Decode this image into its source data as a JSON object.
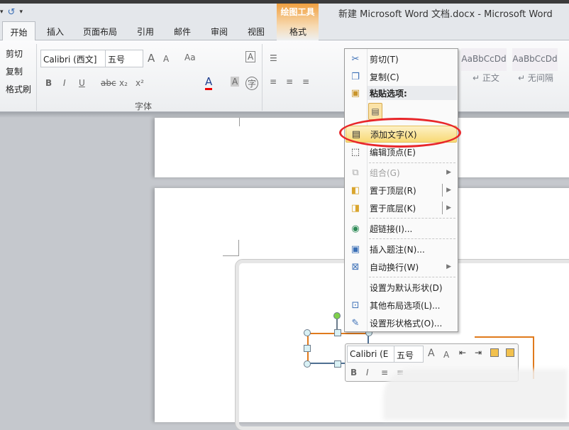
{
  "window": {
    "title": "新建 Microsoft Word 文档.docx  -  Microsoft Word",
    "contextual_group": "绘图工具"
  },
  "tabs": [
    "开始",
    "插入",
    "页面布局",
    "引用",
    "邮件",
    "审阅",
    "视图",
    "格式"
  ],
  "clipboard": {
    "cut": "剪切",
    "copy": "复制",
    "format_painter": "格式刷"
  },
  "font": {
    "name": "Calibri (西文]",
    "size": "五号",
    "group_label": "字体"
  },
  "styles": [
    {
      "preview": "AaBbCcDd",
      "label": "↵ 正文"
    },
    {
      "preview": "AaBbCcDd",
      "label": "↵ 无间隔"
    }
  ],
  "context_menu": {
    "items": [
      {
        "label": "剪切(T)",
        "icon": "scissors-icon"
      },
      {
        "label": "复制(C)",
        "icon": "copy-icon"
      },
      {
        "label": "粘贴选项:",
        "icon": "paste-icon"
      },
      {
        "label": "添加文字(X)",
        "icon": "text-box-icon",
        "highlighted": true
      },
      {
        "label": "编辑顶点(E)",
        "icon": "edit-points-icon"
      },
      {
        "label": "组合(G)",
        "icon": "group-icon",
        "disabled": true
      },
      {
        "label": "置于顶层(R)",
        "icon": "bring-front-icon"
      },
      {
        "label": "置于底层(K)",
        "icon": "send-back-icon"
      },
      {
        "label": "超链接(I)...",
        "icon": "hyperlink-icon"
      },
      {
        "label": "插入题注(N)...",
        "icon": "caption-icon"
      },
      {
        "label": "自动换行(W)",
        "icon": "wrap-text-icon"
      },
      {
        "label": "设置为默认形状(D)",
        "icon": ""
      },
      {
        "label": "其他布局选项(L)...",
        "icon": "layout-icon"
      },
      {
        "label": "设置形状格式(O)...",
        "icon": "format-shape-icon"
      }
    ]
  },
  "mini_toolbar": {
    "font": "Calibri (E",
    "size": "五号"
  },
  "colors": {
    "accent": "#e07a1c",
    "highlight": "#f8d975",
    "annotation": "#e8262a"
  }
}
